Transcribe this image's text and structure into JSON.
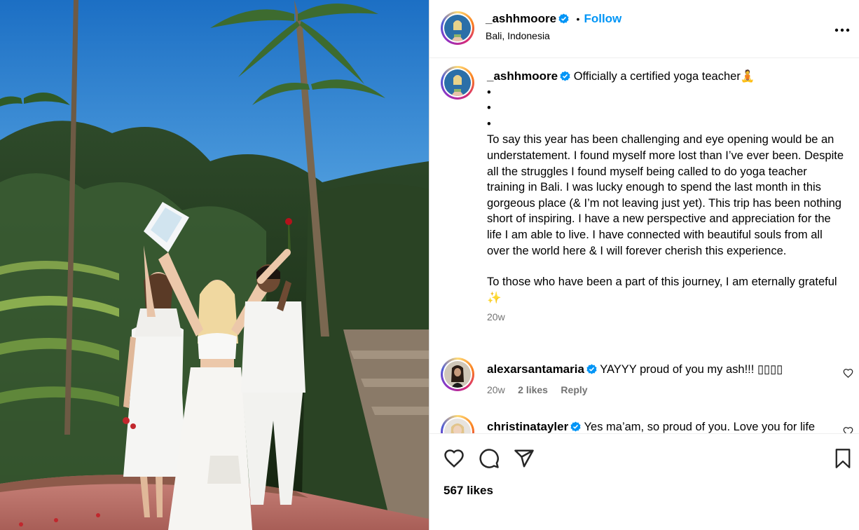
{
  "post": {
    "username": "_ashhmoore",
    "follow_label": "Follow",
    "separator": "•",
    "location": "Bali, Indonesia",
    "more_label": "•••",
    "caption_headline": "Officially a certified yoga teacher",
    "caption_emoji": "🧘",
    "caption_dots": [
      "•",
      "•",
      "•"
    ],
    "caption_paragraph_1": "To say this year has been challenging and eye opening would be an understatement. I found myself more lost than I’ve ever been. Despite all the struggles I found myself being called to do yoga teacher training in Bali. I was lucky enough to spend the last month in this gorgeous place (& I’m not leaving just yet). This trip has been nothing short of inspiring. I have a new perspective and appreciation for the life I am able to live. I have connected with beautiful souls from all over the world here & I will forever cherish this experience.",
    "caption_paragraph_2": "To those who have been a part of this journey, I am eternally grateful",
    "caption_paragraph_2_emoji": "✨",
    "caption_age": "20w",
    "likes_label": "567 likes"
  },
  "comments": [
    {
      "username": "alexarsantamaria",
      "text": "YAYYY proud of you my ash!!! ",
      "emoji_boxes": "▯▯▯▯",
      "age": "20w",
      "likes": "2 likes",
      "reply_label": "Reply"
    },
    {
      "username": "christinatayler",
      "text": "Yes ma’am, so proud of you. Love you for life"
    }
  ],
  "colors": {
    "accent": "#0095f6",
    "verified": "#0095f6",
    "muted_text": "#737373"
  },
  "icons": {
    "like": "heart-icon",
    "comment": "comment-icon",
    "share": "share-icon",
    "save": "bookmark-icon",
    "more": "more-options-icon",
    "verified": "verified-badge-icon"
  }
}
